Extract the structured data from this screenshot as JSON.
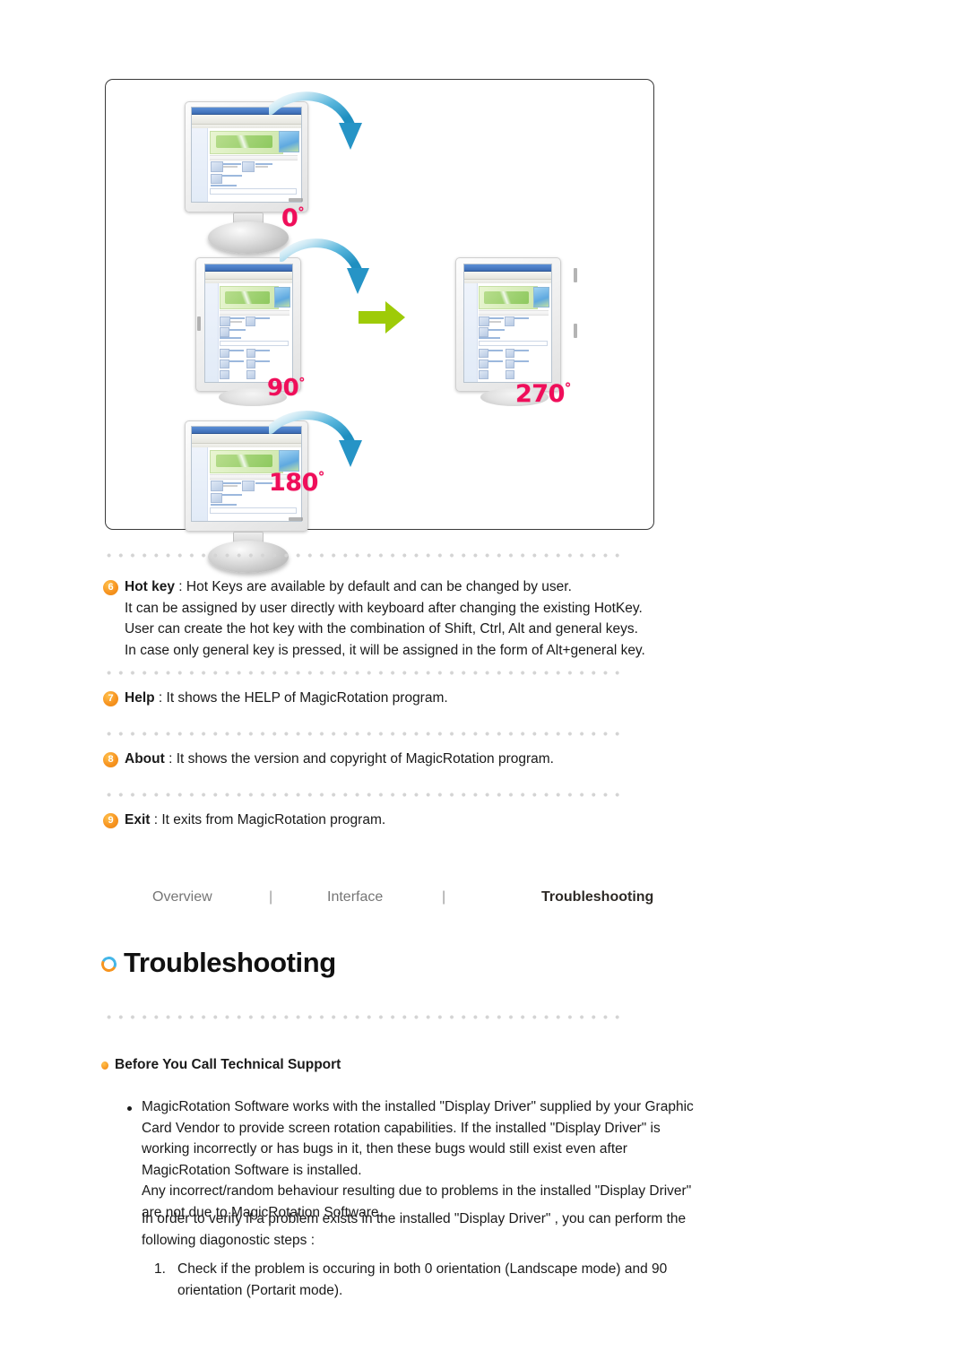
{
  "figure": {
    "alt": "MagicRotation monitor rotation diagram",
    "degree_labels": [
      "0",
      "90",
      "180",
      "270"
    ],
    "degree_symbol": "°",
    "arrow_color_rotation": "#2e9fc9",
    "arrow_color_transition": "#9ecb08",
    "degree_text_color": "#ef0e5a"
  },
  "notes": [
    {
      "num": "6",
      "term": "Hot key",
      "colon": " : ",
      "lines": [
        "Hot Keys are available by default and can be changed by user.",
        "It can be assigned by user directly with keyboard after changing the existing HotKey.",
        "User can create the hot key with the combination of Shift, Ctrl, Alt and general keys.",
        "In case only general key is pressed, it will be assigned in the form of Alt+general key."
      ]
    },
    {
      "num": "7",
      "term": "Help",
      "colon": " : ",
      "lines": [
        "It shows the HELP of MagicRotation program."
      ]
    },
    {
      "num": "8",
      "term": "About",
      "colon": " : ",
      "lines": [
        "It shows the version and copyright of MagicRotation program."
      ]
    },
    {
      "num": "9",
      "term": "Exit",
      "colon": " : ",
      "lines": [
        "It exits from MagicRotation program."
      ]
    }
  ],
  "nav": {
    "items": [
      {
        "label": "Overview",
        "active": false
      },
      {
        "label": "Interface",
        "active": false
      },
      {
        "label": "Troubleshooting",
        "active": true
      }
    ],
    "separator": "|"
  },
  "section": {
    "title": "Troubleshooting",
    "icon": "ring-icon"
  },
  "subsection": {
    "heading": "Before You Call Technical Support",
    "bullet_icon": "orange-dot-icon"
  },
  "content": {
    "bullet_paragraph_lines": [
      "MagicRotation Software works with the installed \"Display Driver\" supplied by your Graphic",
      "Card Vendor to provide screen rotation capabilities. If the installed \"Display Driver\" is",
      "working incorrectly or has bugs in it, then these bugs would still exist even after",
      "MagicRotation Software is installed.",
      "Any incorrect/random behaviour resulting due to problems in the installed \"Display Driver\"",
      "are not due to MagicRotation Software."
    ],
    "intro_lines": [
      "In order to verify if a problem exists in the installed \"Display Driver\" , you can perform the",
      "following diagonostic steps :"
    ],
    "steps": [
      {
        "num": "1.",
        "lines": [
          "Check if the problem is occuring in both 0 orientation (Landscape mode) and 90",
          "orientation (Portarit mode)."
        ]
      }
    ]
  }
}
